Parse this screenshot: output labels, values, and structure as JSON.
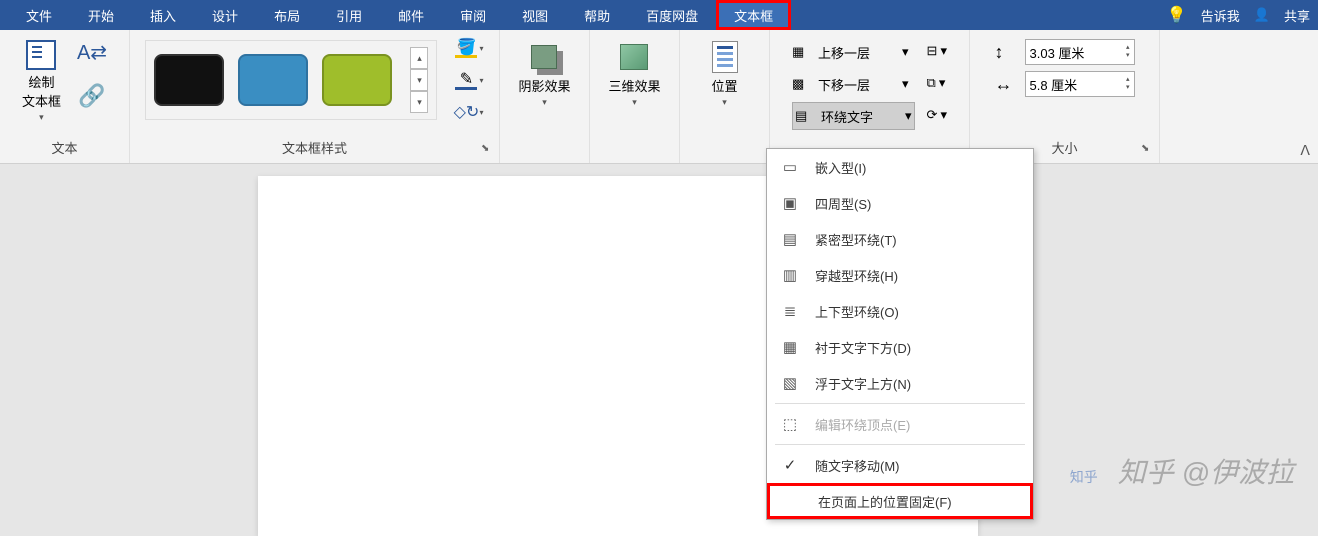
{
  "tabs": {
    "file": "文件",
    "home": "开始",
    "insert": "插入",
    "design": "设计",
    "layout": "布局",
    "references": "引用",
    "mailings": "邮件",
    "review": "审阅",
    "view": "视图",
    "help": "帮助",
    "baidu": "百度网盘",
    "textbox": "文本框",
    "tellme": "告诉我",
    "share": "共享"
  },
  "groups": {
    "text": {
      "label": "文本",
      "drawTextBox": "绘制\n文本框"
    },
    "styles": {
      "label": "文本框样式"
    },
    "shadow": {
      "label": "阴影效果"
    },
    "threeD": {
      "label": "三维效果"
    },
    "position": {
      "label": "位置"
    },
    "arrange": {
      "bringForward": "上移一层",
      "sendBackward": "下移一层",
      "wrapText": "环绕文字"
    },
    "size": {
      "label": "大小",
      "height": "3.03 厘米",
      "width": "5.8 厘米"
    }
  },
  "wrapMenu": {
    "inline": "嵌入型(I)",
    "square": "四周型(S)",
    "tight": "紧密型环绕(T)",
    "through": "穿越型环绕(H)",
    "topBottom": "上下型环绕(O)",
    "behind": "衬于文字下方(D)",
    "inFront": "浮于文字上方(N)",
    "editPoints": "编辑环绕顶点(E)",
    "moveWithText": "随文字移动(M)",
    "fixOnPage": "在页面上的位置固定(F)"
  },
  "watermark": "知乎 @伊波拉"
}
